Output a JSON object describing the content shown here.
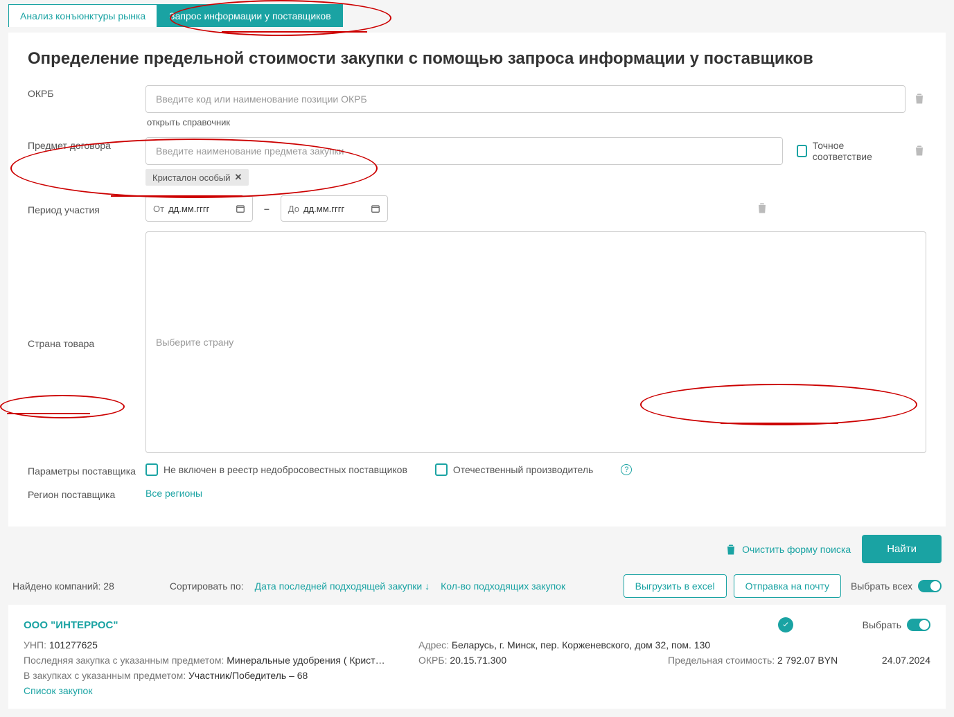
{
  "tabs": {
    "analysis": "Анализ конъюнктуры рынка",
    "request": "Запрос информации у поставщиков"
  },
  "page_title": "Определение предельной стоимости закупки с помощью запроса информации у поставщиков",
  "form": {
    "okrb_label": "ОКРБ",
    "okrb_placeholder": "Введите код или наименование позиции ОКРБ",
    "open_reference": "открыть справочник",
    "subject_label": "Предмет договора",
    "subject_placeholder": "Введите наименование предмета закупки",
    "exact_match": "Точное соответствие",
    "tag": "Кристалон особый",
    "period_label": "Период участия",
    "from_prefix": "От",
    "to_prefix": "До",
    "date_placeholder": "дд.мм.гггг",
    "date_sep": "–",
    "country_label": "Страна товара",
    "country_placeholder": "Выберите страну",
    "params_label": "Параметры поставщика",
    "not_in_blacklist": "Не включен в реестр недобросовестных поставщиков",
    "domestic": "Отечественный производитель",
    "region_label": "Регион поставщика",
    "region_value": "Все регионы"
  },
  "actions": {
    "clear": "Очистить форму поиска",
    "find": "Найти"
  },
  "results": {
    "count_label": "Найдено компаний:",
    "count": "28",
    "sort_label": "Сортировать по:",
    "sort_date": "Дата последней подходящей закупки",
    "sort_qty": "Кол-во подходящих закупок",
    "export_excel": "Выгрузить в excel",
    "send_mail": "Отправка на почту",
    "select_all": "Выбрать всех"
  },
  "company": {
    "name": "ООО \"ИНТЕРРОС\"",
    "select_label": "Выбрать",
    "unp_label": "УНП:",
    "unp": "101277625",
    "addr_label": "Адрес:",
    "addr": "Беларусь, г. Минск, пер. Корженевского, дом 32, пом. 130",
    "last_label": "Последняя закупка с указанным предметом:",
    "last": "Минеральные удобрения ( Крист…",
    "okrb_label": "ОКРБ:",
    "okrb": "20.15.71.300",
    "price_label": "Предельная стоимость:",
    "price": "2 792.07 BYN",
    "date": "24.07.2024",
    "role_label": "В закупках с указанным предметом:",
    "role": "Участник/Победитель – 68",
    "list_link": "Список закупок"
  }
}
